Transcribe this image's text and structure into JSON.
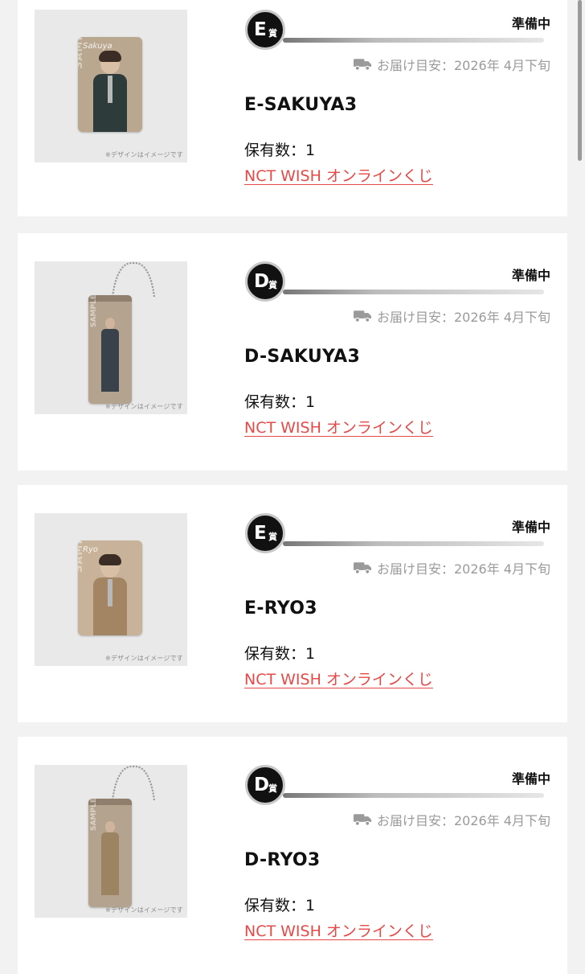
{
  "items": [
    {
      "badge_letter": "E",
      "badge_kanji": "賞",
      "status": "準備中",
      "delivery_label": "お届け目安：",
      "delivery_date": "2026年 4月下旬",
      "name": "E-SAKUYA3",
      "count_label": "保有数：1",
      "link": "NCT WISH オンラインくじ",
      "image_note": "※デザインはイメージです",
      "image_type": "photo-card",
      "image_signature": "Sakuya",
      "image_watermark": "SAMPLE"
    },
    {
      "badge_letter": "D",
      "badge_kanji": "賞",
      "status": "準備中",
      "delivery_label": "お届け目安：",
      "delivery_date": "2026年 4月下旬",
      "name": "D-SAKUYA3",
      "count_label": "保有数：1",
      "link": "NCT WISH オンラインくじ",
      "image_note": "※デザインはイメージです",
      "image_type": "acrylic-keychain",
      "image_watermark": "SAMPLE"
    },
    {
      "badge_letter": "E",
      "badge_kanji": "賞",
      "status": "準備中",
      "delivery_label": "お届け目安：",
      "delivery_date": "2026年 4月下旬",
      "name": "E-RYO3",
      "count_label": "保有数：1",
      "link": "NCT WISH オンラインくじ",
      "image_note": "※デザインはイメージです",
      "image_type": "photo-card",
      "image_signature": "Ryo",
      "image_watermark": "SAMPLE"
    },
    {
      "badge_letter": "D",
      "badge_kanji": "賞",
      "status": "準備中",
      "delivery_label": "お届け目安：",
      "delivery_date": "2026年 4月下旬",
      "name": "D-RYO3",
      "count_label": "保有数：1",
      "link": "NCT WISH オンラインくじ",
      "image_note": "※デザインはイメージです",
      "image_type": "acrylic-keychain",
      "image_watermark": "SAMPLE"
    }
  ],
  "icons": {
    "delivery": "truck-icon"
  },
  "colors": {
    "link": "#e44a47",
    "badge_bg": "#111111",
    "muted_text": "#9a9a9a",
    "page_bg": "#f2f2f2"
  }
}
